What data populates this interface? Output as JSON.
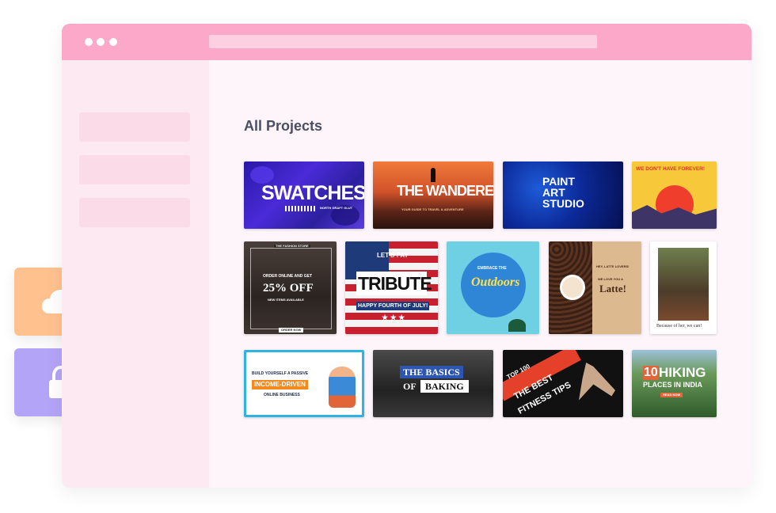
{
  "main": {
    "heading": "All Projects"
  },
  "colors": {
    "titlebar": "#fca8c8",
    "window_bg": "#fdf5f9",
    "sidebar_bg": "#fde9f2",
    "cloud_tile": "#ffc28f",
    "lock_tile": "#b4a4f7"
  },
  "side_tiles": [
    {
      "icon": "cloud-icon"
    },
    {
      "icon": "lock-icon"
    }
  ],
  "thumbnails": {
    "swatches": {
      "title": "SWATCHES",
      "subtitle": "NORTH GRAFT GLUT"
    },
    "wanderer": {
      "title": "THE WANDERER",
      "subtitle": "YOUR GUIDE TO TRAVEL & ADVENTURE"
    },
    "paint_art": {
      "title_1": "PAINT",
      "title_2": "ART",
      "title_3": "STUDIO"
    },
    "forever": {
      "title": "WE DON'T HAVE FOREVER!"
    },
    "off25": {
      "top": "THE FASHION STORE",
      "line": "ORDER ONLINE AND GET",
      "big": "25% OFF",
      "small": "NEW ITEMS AVAILABLE",
      "cta": "ORDER NOW"
    },
    "tribute": {
      "top": "LET'S PAY",
      "big": "TRIBUTE",
      "bottom": "HAPPY FOURTH OF JULY!"
    },
    "outdoors": {
      "top": "EMBRACE THE",
      "script": "Outdoors"
    },
    "latte": {
      "top": "HEY, LATTE LOVERS!",
      "small": "WE LOVE YOU A",
      "big": "Latte!"
    },
    "because": {
      "caption": "Because of her, we can!"
    },
    "income": {
      "line_1": "BUILD YOURSELF A PASSIVE",
      "highlight": "INCOME-DRIVEN",
      "line_3": "ONLINE BUSINESS"
    },
    "baking": {
      "title_1": "THE BASICS",
      "title_2": "OF",
      "title_3": "BAKING"
    },
    "fitness": {
      "top": "TOP 100",
      "big_1": "THE BEST",
      "big_2": "FITNESS TIPS"
    },
    "hiking": {
      "num": "10",
      "word": "HIKING",
      "sub": "PLACES IN INDIA",
      "cta": "READ NOW"
    }
  }
}
